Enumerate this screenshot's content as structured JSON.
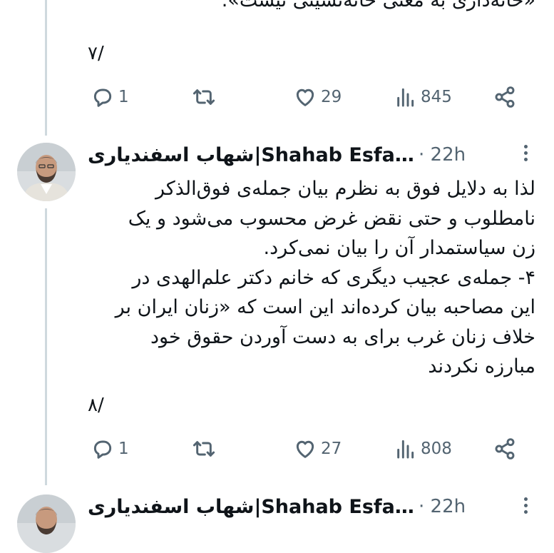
{
  "tweets": [
    {
      "text": "«خانه‌داری به معنی خانه‌نشینی نیست».",
      "page": "۷/",
      "replies": "1",
      "reposts": "",
      "likes": "29",
      "views": "845"
    },
    {
      "author": "شهاب اسفندیاری|Shahab Esfan…",
      "time": "22h",
      "text": "لذا به دلایل فوق به نظرم بیان جمله‌ی فوق‌الذکر\nنامطلوب و حتی نقض غرض محسوب می‌شود و یک\nزن سیاستمدار آن را بیان نمی‌کرد.\n۴- جمله‌ی عجیب دیگری که خانم دکتر علم‌الهدی در\nاین مصاحبه بیان کرده‌اند این است که «زنان ایران بر\nخلاف زنان غرب برای به دست آوردن حقوق خود\nمبارزه نکردند",
      "page": "۸/",
      "replies": "1",
      "reposts": "",
      "likes": "27",
      "views": "808"
    },
    {
      "author": "شهاب اسفندیاری|Shahab Esfan…",
      "time": "22h"
    }
  ],
  "icons": {
    "reply": "reply-icon",
    "repost": "repost-icon",
    "like": "heart-icon",
    "views": "views-icon",
    "share": "share-icon",
    "more": "more-icon"
  },
  "colors": {
    "text": "#0f1419",
    "muted": "#536471",
    "thread_line": "#cfd9de",
    "background": "#ffffff"
  }
}
